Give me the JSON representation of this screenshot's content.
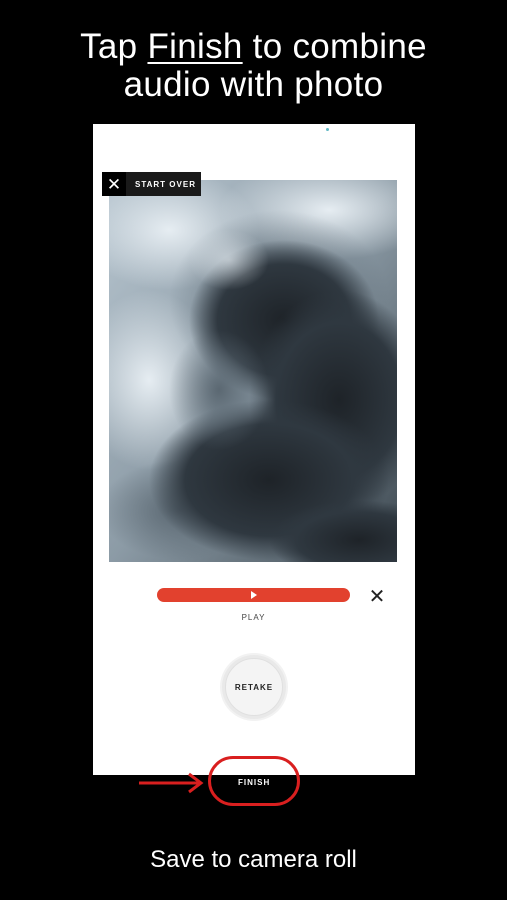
{
  "headline": {
    "prefix": "Tap ",
    "emphasis": "Finish",
    "line1_suffix": " to combine",
    "line2": "audio with photo"
  },
  "editor": {
    "start_over_label": "START OVER",
    "close_icon": "close-icon",
    "play_label": "PLAY",
    "play_icon": "play-icon",
    "delete_audio_icon": "close-icon",
    "retake_label": "RETAKE",
    "audio_bar_color": "#e2412e"
  },
  "finish": {
    "label": "FINISH",
    "highlight_color": "#d91f1f",
    "arrow_icon": "arrow-right-icon"
  },
  "caption": "Save to camera roll"
}
